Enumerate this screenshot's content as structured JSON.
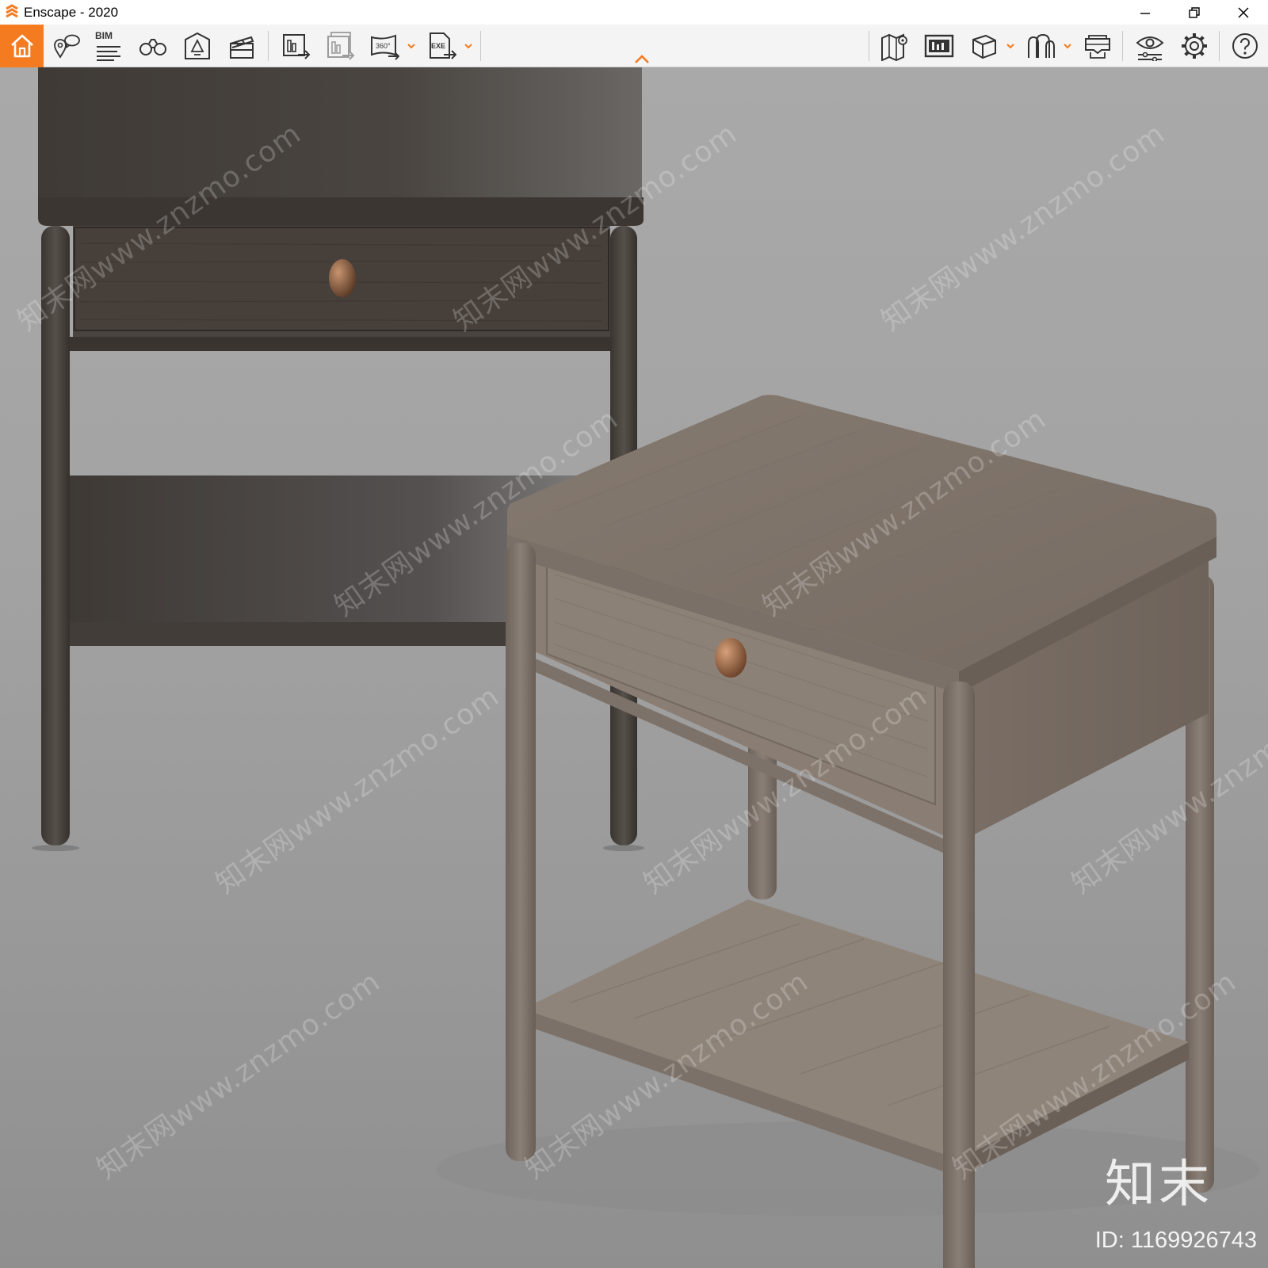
{
  "window": {
    "title": "Enscape - 2020",
    "accent_color": "#f47b20"
  },
  "toolbar": {
    "left_tools": [
      {
        "name": "home",
        "icon": "home-icon"
      },
      {
        "name": "views",
        "icon": "map-pin-chat-icon"
      },
      {
        "name": "bim",
        "icon": "bim-list-icon",
        "label": "BIM"
      },
      {
        "name": "walk-mode",
        "icon": "binoculars-icon"
      },
      {
        "name": "light-view",
        "icon": "lightbulb-house-icon"
      },
      {
        "name": "video-editor",
        "icon": "clapperboard-icon"
      },
      {
        "name": "render-image",
        "icon": "render-image-icon"
      },
      {
        "name": "batch-render",
        "icon": "batch-render-icon"
      },
      {
        "name": "render-panorama",
        "icon": "panorama-360-icon",
        "label": "360°"
      },
      {
        "name": "export-exe",
        "icon": "export-exe-icon",
        "label": "EXE"
      }
    ],
    "right_tools": [
      {
        "name": "map",
        "icon": "map-pin-icon"
      },
      {
        "name": "screen-export",
        "icon": "screen-export-icon"
      },
      {
        "name": "view-cube",
        "icon": "cube-icon"
      },
      {
        "name": "people",
        "icon": "people-icon"
      },
      {
        "name": "vr",
        "icon": "vr-headset-icon"
      },
      {
        "name": "visual-settings",
        "icon": "eye-sliders-icon"
      },
      {
        "name": "settings",
        "icon": "gear-icon"
      },
      {
        "name": "help",
        "icon": "help-icon"
      }
    ]
  },
  "viewport": {
    "watermark_text": "知末网www.znzmo.com",
    "brand_mark": "知末",
    "image_id": "ID: 1169926743"
  }
}
